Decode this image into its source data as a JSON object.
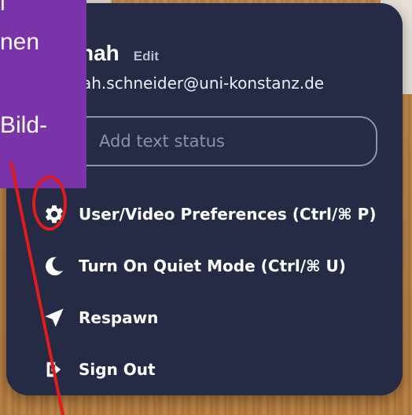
{
  "user": {
    "name_visible": "nah",
    "edit_label": "Edit",
    "email_visible": "ah.schneider@uni-konstanz.de"
  },
  "status": {
    "placeholder": "Add text status"
  },
  "menu": {
    "items": [
      {
        "icon": "gear-icon",
        "label": "User/Video Preferences (Ctrl/⌘ P)"
      },
      {
        "icon": "moon-icon",
        "label": "Turn On Quiet Mode (Ctrl/⌘ U)"
      },
      {
        "icon": "paper-plane-icon",
        "label": "Respawn"
      },
      {
        "icon": "sign-out-icon",
        "label": "Sign Out"
      }
    ]
  },
  "overlay": {
    "line1": "l",
    "line2": "nen",
    "line3": "Bild-"
  },
  "colors": {
    "panel_bg": "#262b45",
    "overlay_bg": "#7a33a8",
    "annotation": "#e21b1b"
  }
}
